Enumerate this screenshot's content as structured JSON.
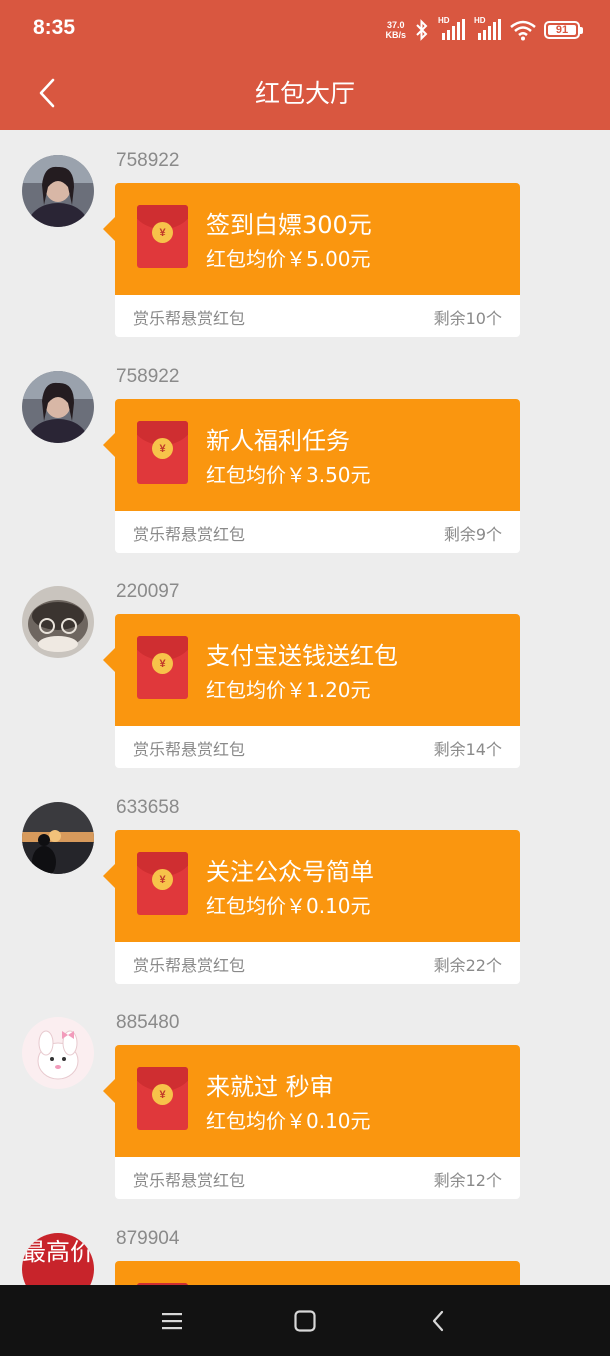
{
  "status_bar": {
    "time": "8:35",
    "net_speed_value": "37.0",
    "net_speed_unit": "KB/s",
    "signal_label_1": "HD",
    "signal_label_2": "HD",
    "battery": "91"
  },
  "header": {
    "title": "红包大厅",
    "back_icon": "chevron-left-icon"
  },
  "colors": {
    "header_bg": "#d95740",
    "card_orange": "#fa960f",
    "envelope_red": "#e0383b",
    "page_bg": "#ededed"
  },
  "items": [
    {
      "user": "758922",
      "title": "签到白嫖300元",
      "price": "红包均价￥5.00元",
      "source": "赏乐帮悬赏红包",
      "remaining": "剩余10个"
    },
    {
      "user": "758922",
      "title": "新人福利任务",
      "price": "红包均价￥3.50元",
      "source": "赏乐帮悬赏红包",
      "remaining": "剩余9个"
    },
    {
      "user": "220097",
      "title": "支付宝送钱送红包",
      "price": "红包均价￥1.20元",
      "source": "赏乐帮悬赏红包",
      "remaining": "剩余14个"
    },
    {
      "user": "633658",
      "title": "关注公众号简单",
      "price": "红包均价￥0.10元",
      "source": "赏乐帮悬赏红包",
      "remaining": "剩余22个"
    },
    {
      "user": "885480",
      "title": "来就过 秒审",
      "price": "红包均价￥0.10元",
      "source": "赏乐帮悬赏红包",
      "remaining": "剩余12个"
    },
    {
      "user": "879904",
      "avatar_text": "最高价"
    }
  ],
  "envelope_symbol": "¥"
}
